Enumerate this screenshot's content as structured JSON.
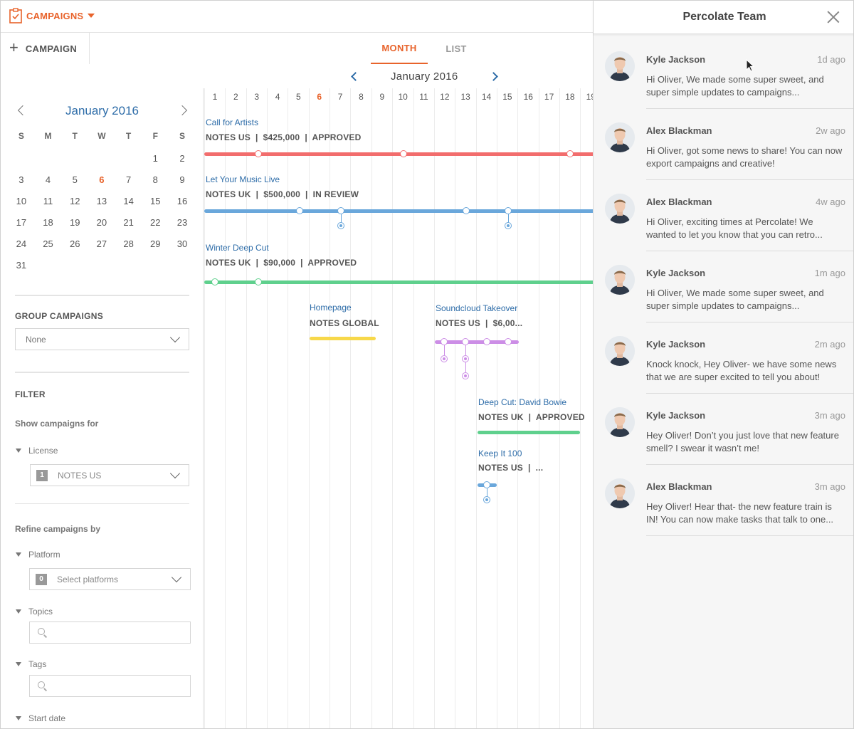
{
  "topbar": {
    "brand_label": "CAMPAIGNS"
  },
  "subbar": {
    "add_campaign_label": "CAMPAIGN",
    "tabs": [
      {
        "label": "MONTH",
        "active": true
      },
      {
        "label": "LIST",
        "active": false
      }
    ]
  },
  "month_nav": {
    "title": "January 2016"
  },
  "mini_calendar": {
    "title": "January 2016",
    "weekdays": [
      "S",
      "M",
      "T",
      "W",
      "T",
      "F",
      "S"
    ],
    "leading_blanks": 5,
    "days": 31,
    "today": 6
  },
  "sidebar": {
    "group_campaigns_label": "GROUP CAMPAIGNS",
    "group_value": "None",
    "filter_label": "FILTER",
    "show_campaigns_for_label": "Show campaigns for",
    "license_label": "License",
    "license_count": "1",
    "license_value": "NOTES US",
    "refine_label": "Refine campaigns by",
    "platform_label": "Platform",
    "platform_count": "0",
    "platform_placeholder": "Select platforms",
    "topics_label": "Topics",
    "tags_label": "Tags",
    "start_date_label": "Start date"
  },
  "timeline": {
    "days": [
      "1",
      "2",
      "3",
      "4",
      "5",
      "6",
      "7",
      "8",
      "9",
      "10",
      "11",
      "12",
      "13",
      "14",
      "15",
      "16",
      "17",
      "18",
      "19"
    ],
    "today": "6",
    "campaigns": [
      {
        "name": "Call for Artists",
        "meta": "NOTES US  |  $425,000  |  APPROVED",
        "color": "#f26d6d"
      },
      {
        "name": "Let Your Music Live",
        "meta": "NOTES UK  |  $500,000  |  IN REVIEW",
        "color": "#6aa7db"
      },
      {
        "name": "Winter Deep Cut",
        "meta": "NOTES UK  |  $90,000  |  APPROVED",
        "color": "#5fd08d"
      },
      {
        "name": "Homepage",
        "meta": "NOTES GLOBAL",
        "color": "#f7d84a"
      },
      {
        "name": "Soundcloud Takeover",
        "meta": "NOTES US  |  $6,00...",
        "color": "#cc8ee6"
      },
      {
        "name": "Deep Cut: David Bowie",
        "meta": "NOTES UK  |  APPROVED",
        "color": "#5fd08d"
      },
      {
        "name": "Keep It 100",
        "meta": "NOTES US  |  ...",
        "color": "#6aa7db"
      }
    ]
  },
  "panel": {
    "title": "Percolate Team",
    "messages": [
      {
        "name": "Kyle Jackson",
        "time": "1d ago",
        "preview": "Hi Oliver, We made some super sweet, and super simple updates to campaigns..."
      },
      {
        "name": "Alex Blackman",
        "time": "2w ago",
        "preview": "Hi Oliver, got some news to share! You can now export campaigns and creative!"
      },
      {
        "name": "Alex Blackman",
        "time": "4w ago",
        "preview": "Hi Oliver, exciting times at Percolate! We wanted to let you know that you can retro..."
      },
      {
        "name": "Kyle Jackson",
        "time": "1m ago",
        "preview": "Hi Oliver, We made some super sweet, and super simple updates to campaigns..."
      },
      {
        "name": "Kyle Jackson",
        "time": "2m ago",
        "preview": "Knock knock, Hey Oliver- we have some news that we are super excited to tell you about!"
      },
      {
        "name": "Kyle Jackson",
        "time": "3m ago",
        "preview": "Hey Oliver! Don’t you just love that new feature smell? I swear it wasn’t me!"
      },
      {
        "name": "Alex Blackman",
        "time": "3m ago",
        "preview": "Hey Oliver! Hear that- the new feature train is IN! You can now make tasks that talk to one..."
      }
    ]
  },
  "colors": {
    "accent": "#e8632b",
    "link": "#2d6ca8"
  }
}
